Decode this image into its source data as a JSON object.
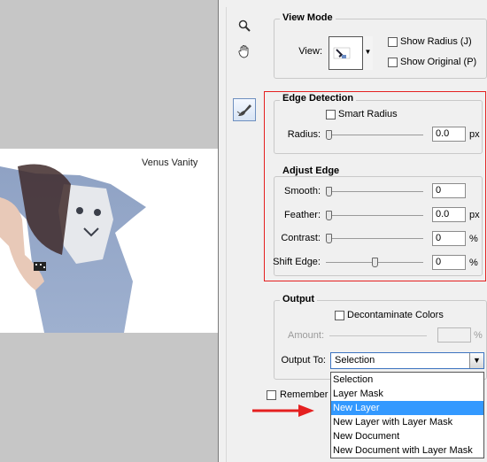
{
  "canvas": {
    "watermark": "Venus Vanity"
  },
  "tools": {
    "zoom_icon": "zoom-icon",
    "hand_icon": "hand-icon",
    "refine_icon": "refine-radius-brush-icon"
  },
  "view_mode": {
    "title": "View Mode",
    "view_label": "View:",
    "show_radius": "Show Radius (J)",
    "show_original": "Show Original (P)"
  },
  "edge_detection": {
    "title": "Edge Detection",
    "smart_radius": "Smart Radius",
    "radius_label": "Radius:",
    "radius_value": "0.0",
    "radius_unit": "px",
    "radius_level": 0
  },
  "adjust_edge": {
    "title": "Adjust Edge",
    "smooth_label": "Smooth:",
    "smooth_value": "0",
    "smooth_level": 0,
    "feather_label": "Feather:",
    "feather_value": "0.0",
    "feather_unit": "px",
    "feather_level": 0,
    "contrast_label": "Contrast:",
    "contrast_value": "0",
    "contrast_unit": "%",
    "contrast_level": 0,
    "shift_label": "Shift Edge:",
    "shift_value": "0",
    "shift_unit": "%",
    "shift_level": 0.5
  },
  "output": {
    "title": "Output",
    "decontaminate": "Decontaminate Colors",
    "amount_label": "Amount:",
    "amount_unit": "%",
    "output_to_label": "Output To:",
    "output_to_value": "Selection",
    "options": [
      "Selection",
      "Layer Mask",
      "New Layer",
      "New Layer with Layer Mask",
      "New Document",
      "New Document with Layer Mask"
    ],
    "highlighted_option": "New Layer"
  },
  "remember": {
    "label": "Remember Settings"
  },
  "colors": {
    "annotation_red": "#e52020",
    "highlight_blue": "#3399ff"
  }
}
